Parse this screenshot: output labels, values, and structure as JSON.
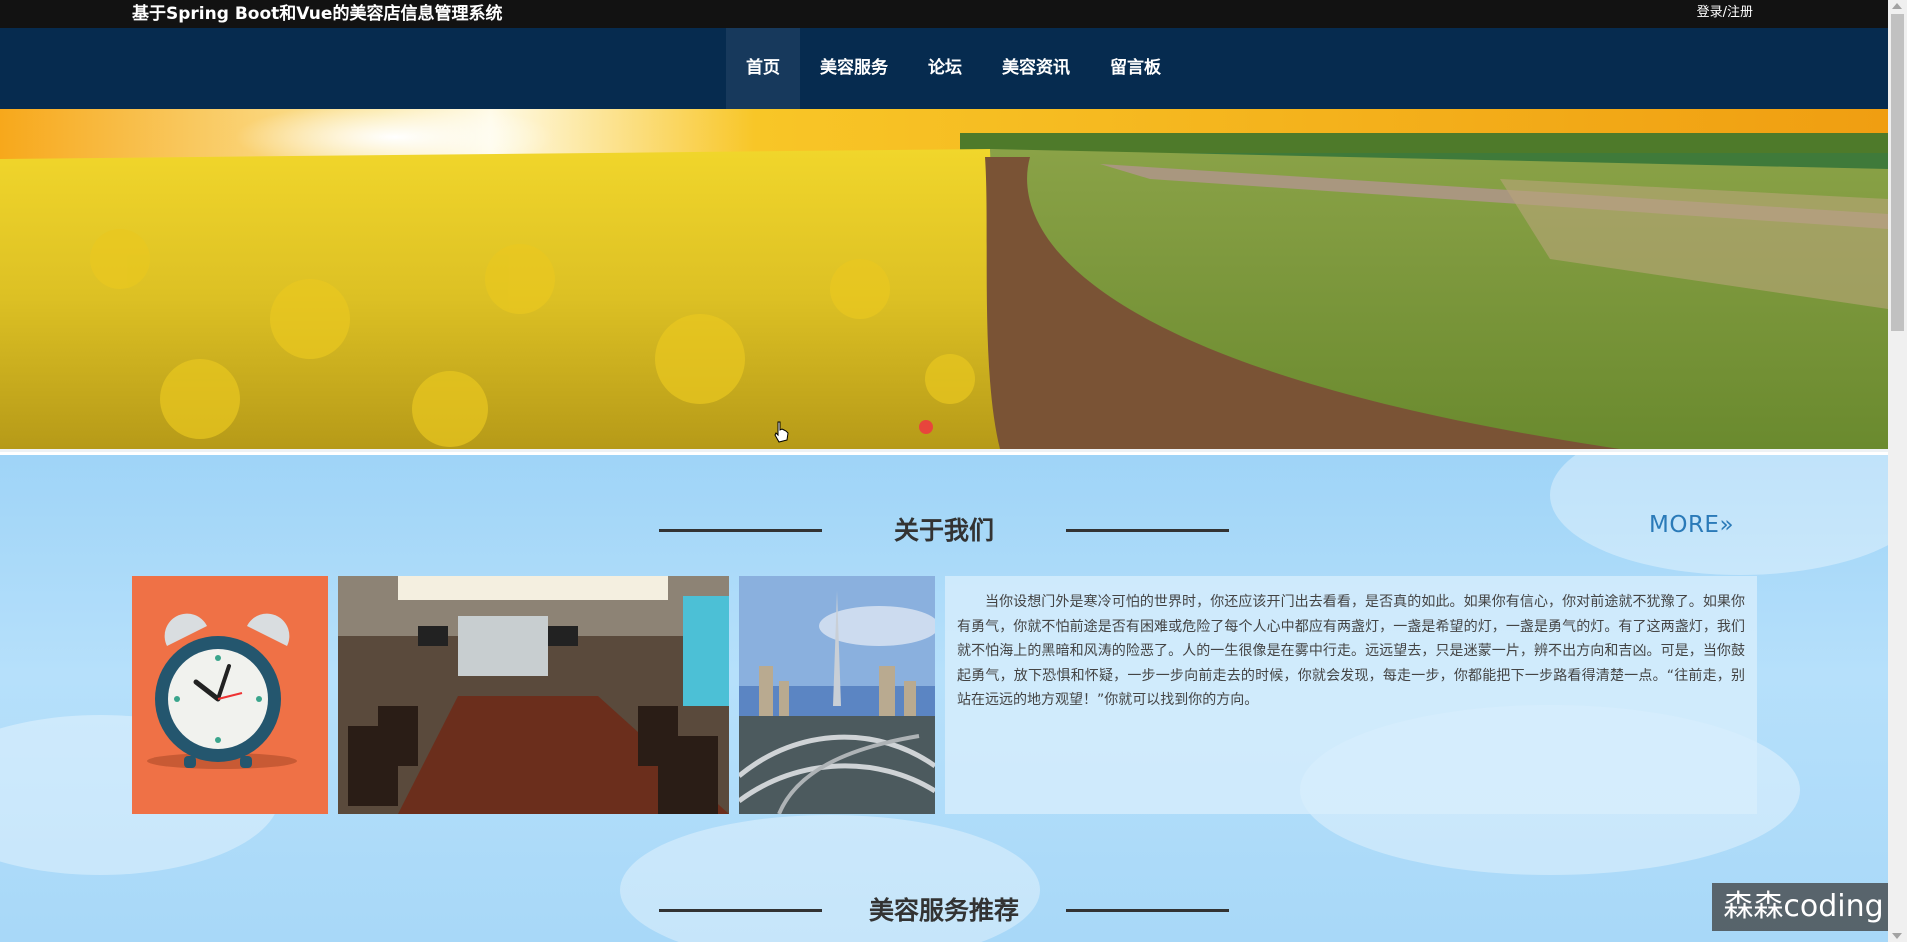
{
  "header": {
    "site_title": "基于Spring Boot和Vue的美容店信息管理系统",
    "login_label": "登录/注册"
  },
  "nav": {
    "items": [
      {
        "label": "首页",
        "active": true
      },
      {
        "label": "美容服务",
        "active": false
      },
      {
        "label": "论坛",
        "active": false
      },
      {
        "label": "美容资讯",
        "active": false
      },
      {
        "label": "留言板",
        "active": false
      }
    ]
  },
  "banner": {
    "carousel_indicator": "active-dot"
  },
  "about": {
    "title": "关于我们",
    "more_label": "MORE»",
    "text": "当你设想门外是寒冷可怕的世界时，你还应该开门出去看看，是否真的如此。如果你有信心，你对前途就不犹豫了。如果你有勇气，你就不怕前途是否有困难或危险了每个人心中都应有两盏灯，一盏是希望的灯，一盏是勇气的灯。有了这两盏灯，我们就不怕海上的黑暗和风涛的险恶了。人的一生很像是在雾中行走。远远望去，只是迷蒙一片，辨不出方向和吉凶。可是，当你鼓起勇气，放下恐惧和怀疑，一步一步向前走去的时候，你就会发现，每走一步，你都能把下一步路看得清楚一点。“往前走，别站在远远的地方观望！”你就可以找到你的方向。",
    "images": [
      "alarm-clock-illustration",
      "conference-room-photo",
      "city-skyline-photo"
    ]
  },
  "services": {
    "title": "美容服务推荐"
  },
  "watermark": {
    "text": "森森coding"
  },
  "colors": {
    "topbar": "#121212",
    "navbar": "#062b4f",
    "nav_active": "#17395c",
    "more_link": "#2a7ab8",
    "section_bg": "#a8d8f8"
  }
}
